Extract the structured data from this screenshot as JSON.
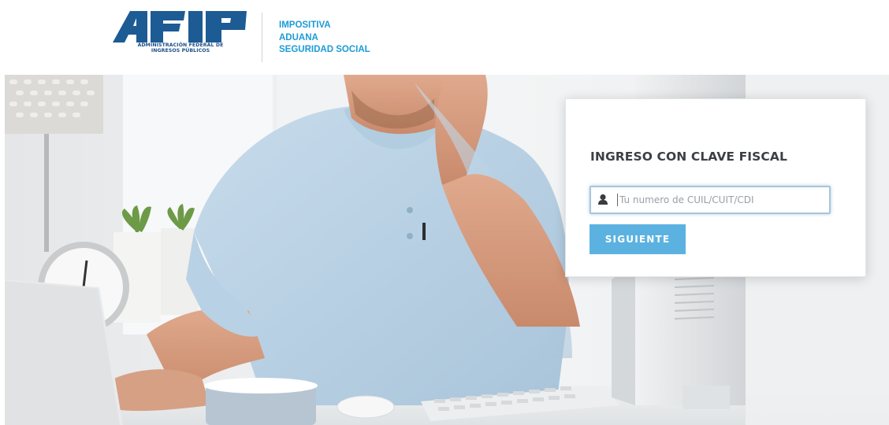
{
  "brand": {
    "logo_text": "AFIP",
    "logo_subtitle_line1": "ADMINISTRACIÓN FEDERAL DE",
    "logo_subtitle_line2": "INGRESOS PÚBLICOS",
    "taglines": [
      "IMPOSITIVA",
      "ADUANA",
      "SEGURIDAD SOCIAL"
    ],
    "brand_color": "#1d4f8a",
    "accent_color": "#1b9bd7"
  },
  "login": {
    "title": "INGRESO CON CLAVE FISCAL",
    "input_placeholder": "Tu numero de CUIL/CUIT/CDI",
    "input_value": "",
    "user_icon": "user-icon",
    "submit_label": "SIGUIENTE",
    "button_color": "#5bb2e0"
  }
}
